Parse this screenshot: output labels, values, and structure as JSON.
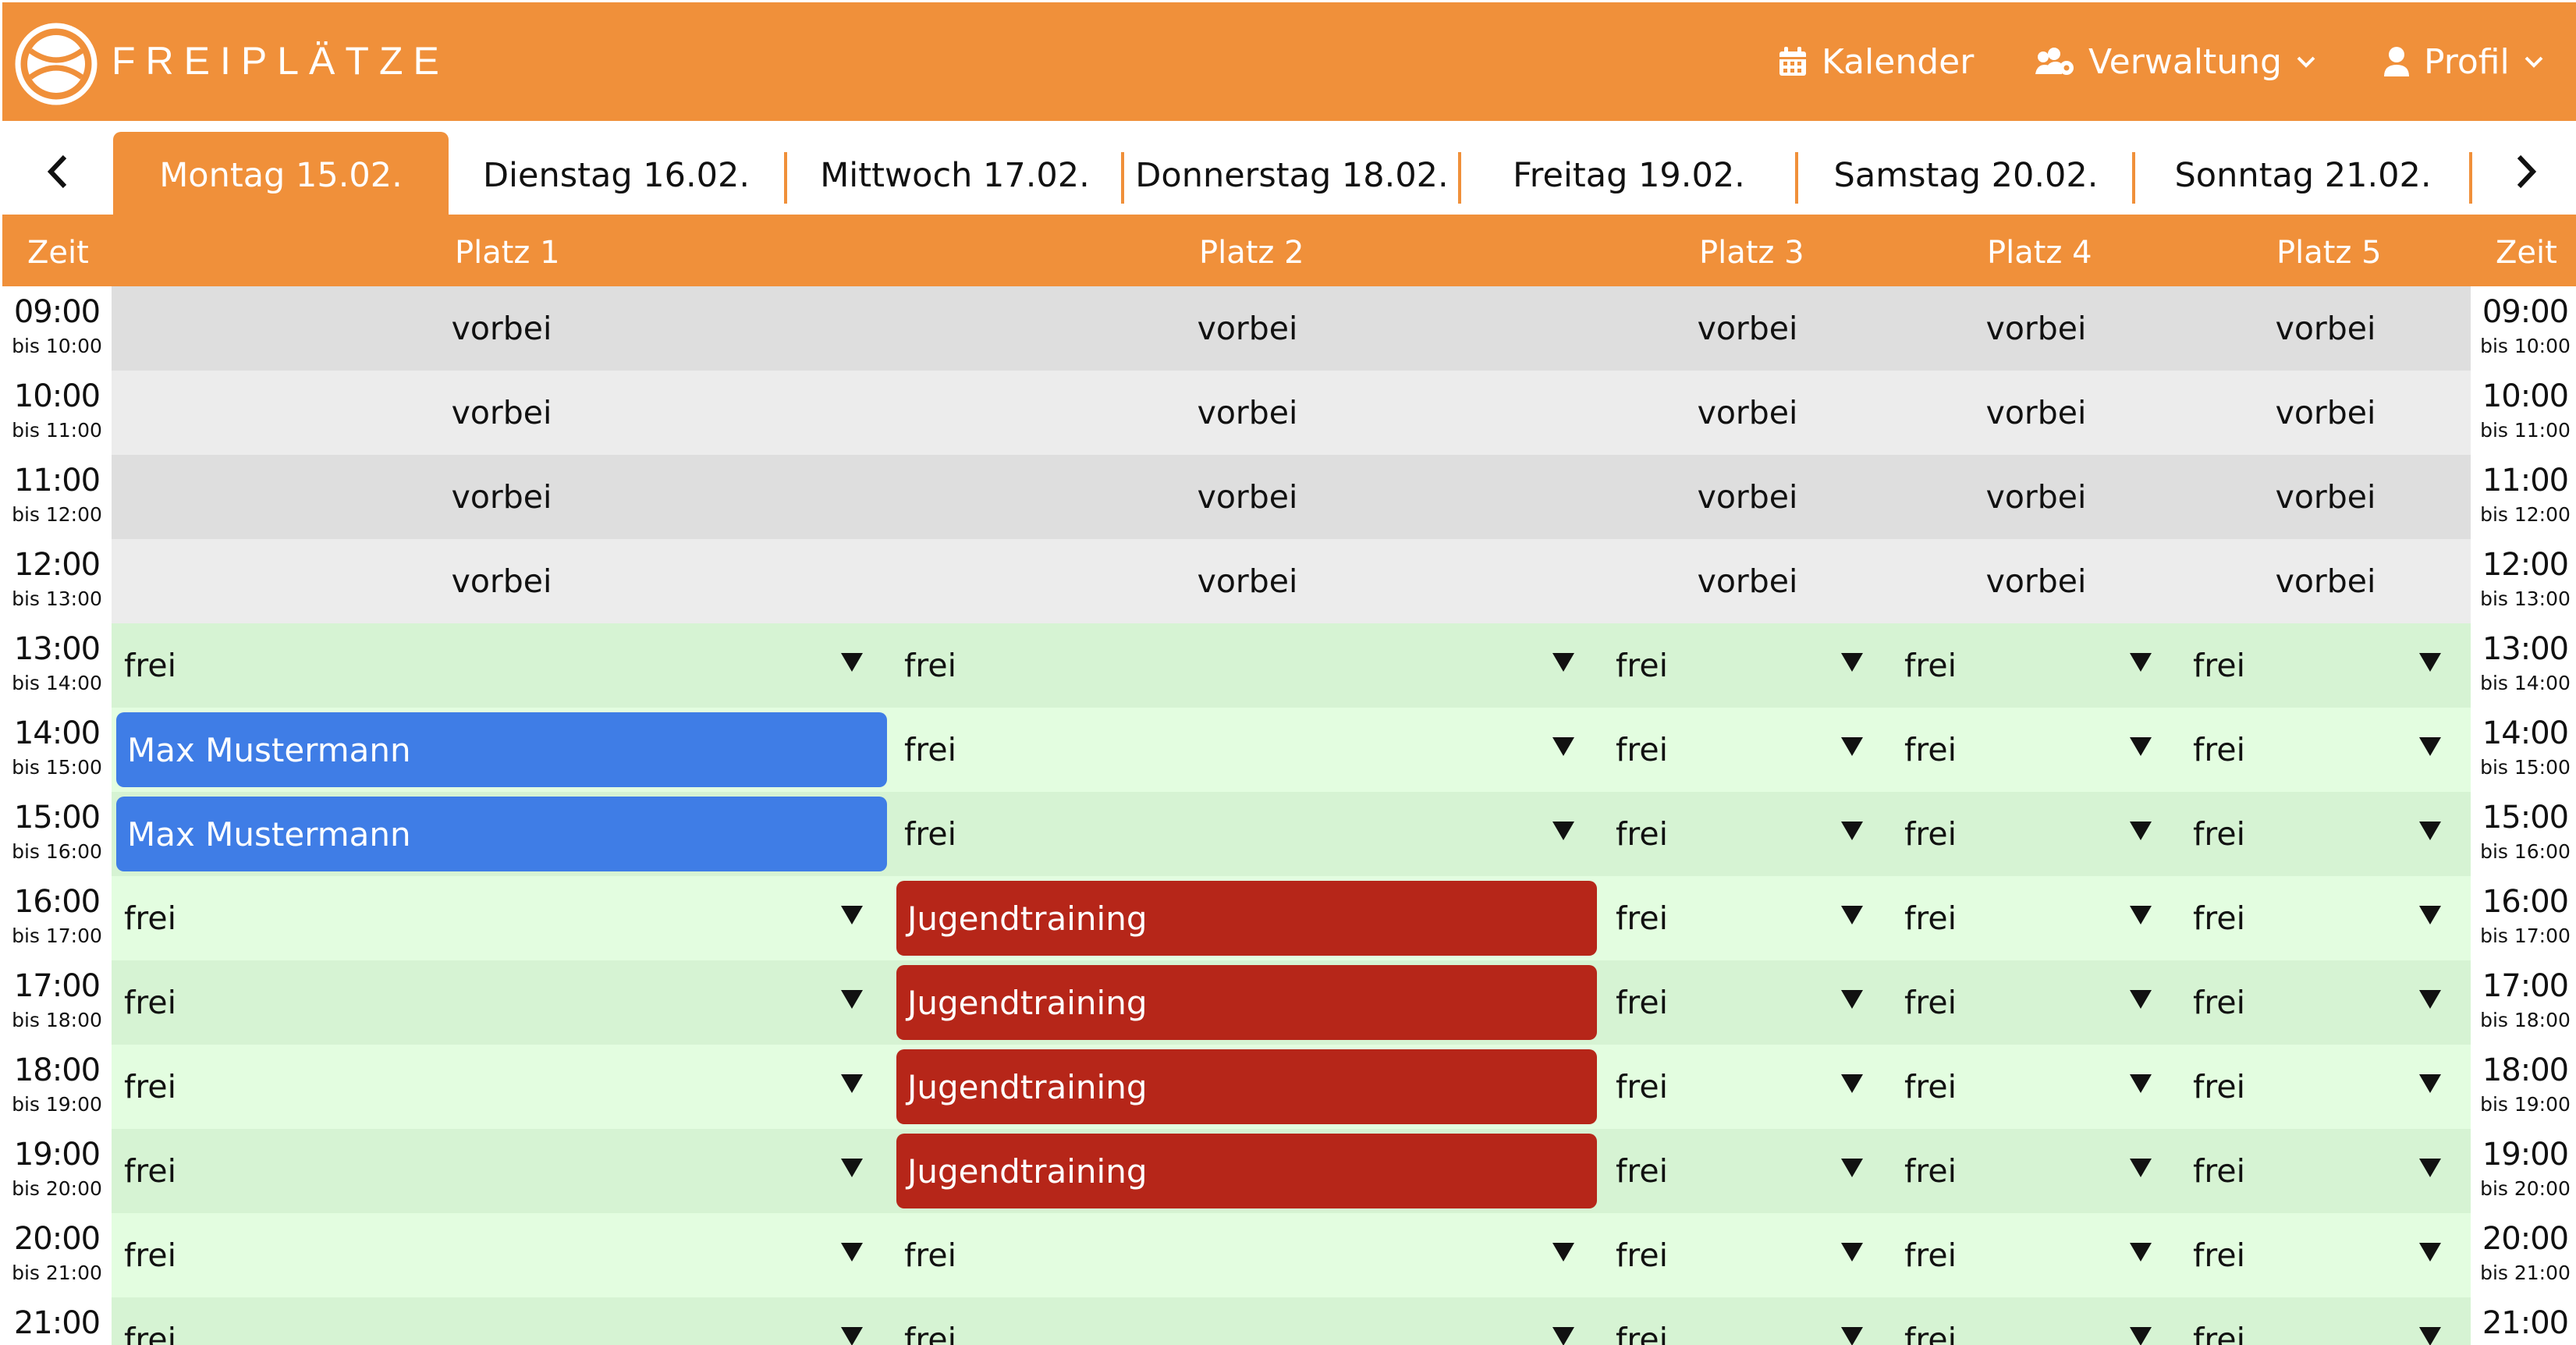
{
  "header": {
    "brand": "FREIPLÄTZE",
    "nav": [
      {
        "label": "Kalender",
        "icon": "calendar-icon"
      },
      {
        "label": "Verwaltung",
        "icon": "users-cog-icon"
      },
      {
        "label": "Profil",
        "icon": "user-icon"
      }
    ]
  },
  "days": [
    {
      "label": "Montag 15.02.",
      "active": true
    },
    {
      "label": "Dienstag 16.02.",
      "active": false
    },
    {
      "label": "Mittwoch 17.02.",
      "active": false
    },
    {
      "label": "Donnerstag 18.02.",
      "active": false
    },
    {
      "label": "Freitag 19.02.",
      "active": false
    },
    {
      "label": "Samstag 20.02.",
      "active": false
    },
    {
      "label": "Sonntag 21.02.",
      "active": false
    }
  ],
  "columns": {
    "time": "Zeit",
    "courts": [
      "Platz 1",
      "Platz 2",
      "Platz 3",
      "Platz 4",
      "Platz 5"
    ]
  },
  "rows": [
    {
      "time": "09:00",
      "until": "bis 10:00",
      "cells": [
        "vorbei",
        "vorbei",
        "vorbei",
        "vorbei",
        "vorbei"
      ]
    },
    {
      "time": "10:00",
      "until": "bis 11:00",
      "cells": [
        "vorbei",
        "vorbei",
        "vorbei",
        "vorbei",
        "vorbei"
      ]
    },
    {
      "time": "11:00",
      "until": "bis 12:00",
      "cells": [
        "vorbei",
        "vorbei",
        "vorbei",
        "vorbei",
        "vorbei"
      ]
    },
    {
      "time": "12:00",
      "until": "bis 13:00",
      "cells": [
        "vorbei",
        "vorbei",
        "vorbei",
        "vorbei",
        "vorbei"
      ]
    },
    {
      "time": "13:00",
      "until": "bis 14:00",
      "cells": [
        "frei",
        "frei",
        "frei",
        "frei",
        "frei"
      ]
    },
    {
      "time": "14:00",
      "until": "bis 15:00",
      "cells": [
        "Max Mustermann",
        "frei",
        "frei",
        "frei",
        "frei"
      ]
    },
    {
      "time": "15:00",
      "until": "bis 16:00",
      "cells": [
        "Max Mustermann",
        "frei",
        "frei",
        "frei",
        "frei"
      ]
    },
    {
      "time": "16:00",
      "until": "bis 17:00",
      "cells": [
        "frei",
        "Jugendtraining",
        "frei",
        "frei",
        "frei"
      ]
    },
    {
      "time": "17:00",
      "until": "bis 18:00",
      "cells": [
        "frei",
        "Jugendtraining",
        "frei",
        "frei",
        "frei"
      ]
    },
    {
      "time": "18:00",
      "until": "bis 19:00",
      "cells": [
        "frei",
        "Jugendtraining",
        "frei",
        "frei",
        "frei"
      ]
    },
    {
      "time": "19:00",
      "until": "bis 20:00",
      "cells": [
        "frei",
        "Jugendtraining",
        "frei",
        "frei",
        "frei"
      ]
    },
    {
      "time": "20:00",
      "until": "bis 21:00",
      "cells": [
        "frei",
        "frei",
        "frei",
        "frei",
        "frei"
      ]
    },
    {
      "time": "21:00",
      "until": "",
      "cells": [
        "frei",
        "frei",
        "frei",
        "frei",
        "frei"
      ]
    }
  ],
  "colors": {
    "brand": "#f0903a",
    "past_row_a": "#dedede",
    "past_row_b": "#ececec",
    "free_row_a": "#d6f3d3",
    "free_row_b": "#e3fde0",
    "booking_member": "#3f7de6",
    "booking_training": "#b62619"
  }
}
